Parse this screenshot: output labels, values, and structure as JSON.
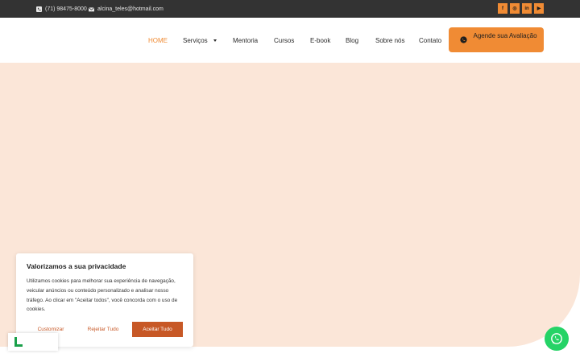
{
  "topbar": {
    "phone": "(71) 98475-8000",
    "email": "alcina_teles@hotmail.com",
    "phone_icon": "phone-icon",
    "email_icon": "envelope-icon",
    "socials": [
      {
        "name": "facebook-icon",
        "glyph": "f"
      },
      {
        "name": "instagram-icon",
        "glyph": "◎"
      },
      {
        "name": "linkedin-icon",
        "glyph": "in"
      },
      {
        "name": "youtube-icon",
        "glyph": "▶"
      }
    ]
  },
  "nav": {
    "items": [
      {
        "label": "HOME",
        "active": true
      },
      {
        "label": "Serviços",
        "dropdown": true
      },
      {
        "label": "Mentoria"
      },
      {
        "label": "Cursos"
      },
      {
        "label": "E-book"
      },
      {
        "label": "Blog"
      },
      {
        "label": "Sobre nós"
      },
      {
        "label": "Contato"
      }
    ],
    "cta": {
      "label": "Agende sua Avaliação",
      "icon": "whatsapp-icon"
    }
  },
  "cookie": {
    "title": "Valorizamos a sua privacidade",
    "text": "Utilizamos cookies para melhorar sua experiência de navegação, veicular anúncios ou conteúdo personalizado e analisar nosso tráfego. Ao clicar em \"Aceitar todos\", você concorda com o uso de cookies.",
    "customize": "Customizar",
    "reject": "Rejeitar Tudo",
    "accept": "Aceitar Tudo"
  },
  "floating": {
    "icon": "whatsapp-icon"
  },
  "colors": {
    "accent": "#f08b34",
    "topbar": "#333333",
    "hero": "#fbe6d8",
    "cookie_accent": "#c75826",
    "whatsapp": "#25d366"
  }
}
